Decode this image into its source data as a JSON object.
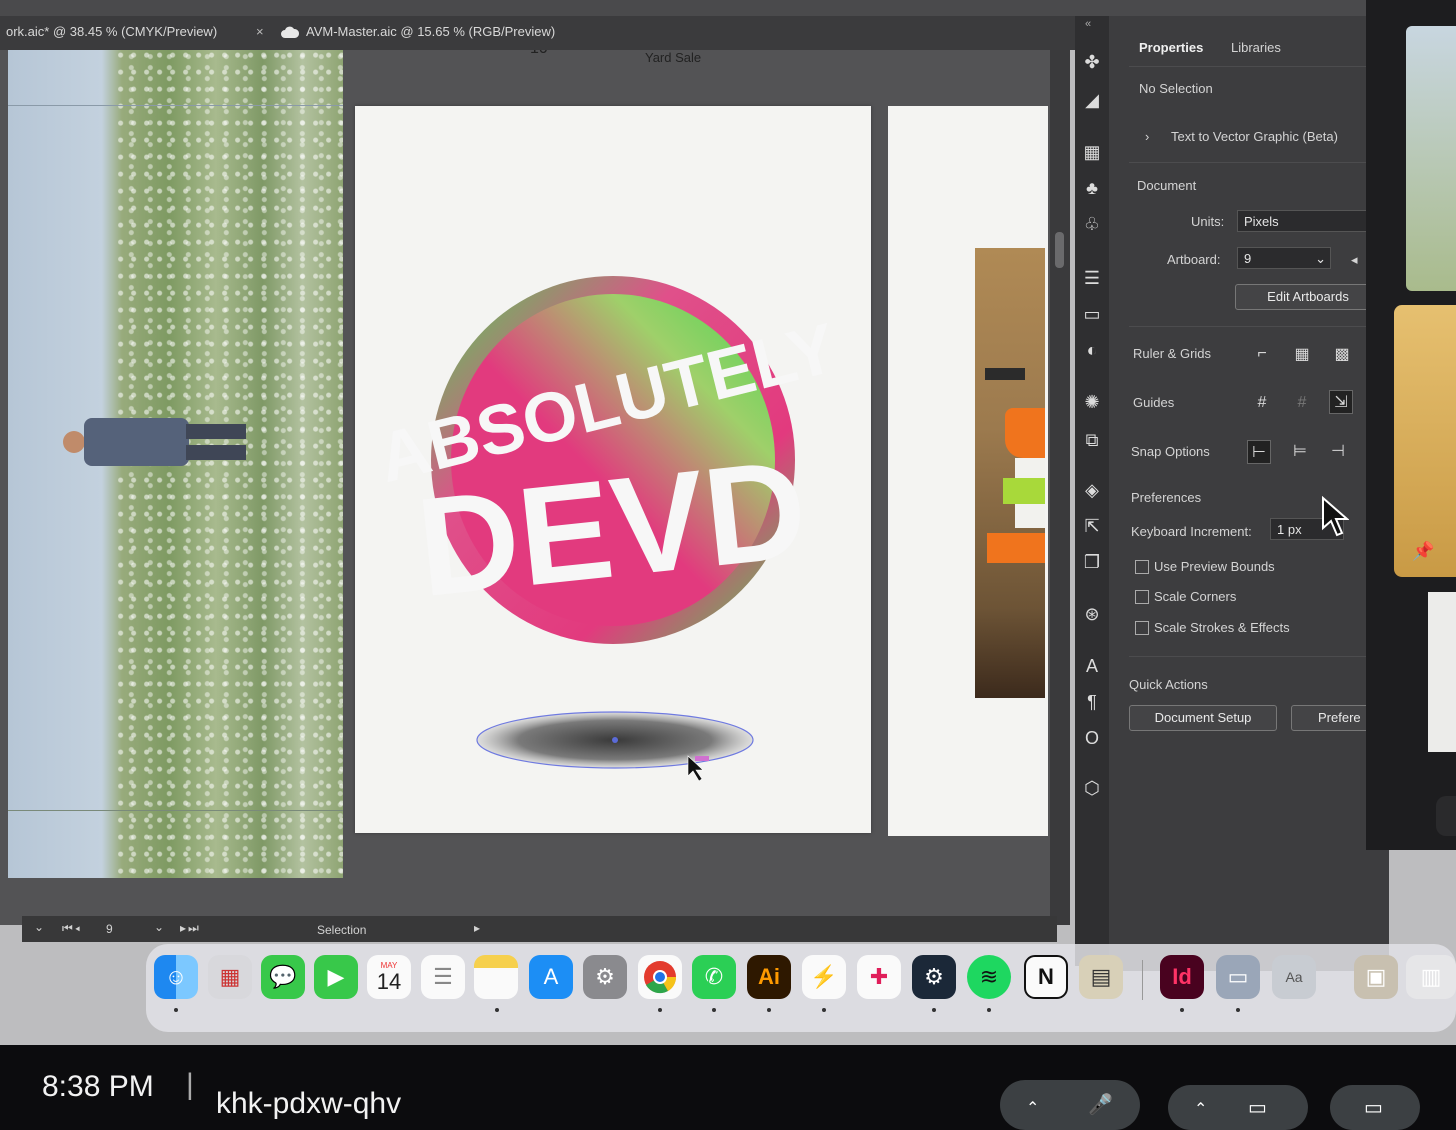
{
  "document_tabs": {
    "tab1": "ork.aic* @ 38.45 % (CMYK/Preview)",
    "tab1_close": "×",
    "tab2": "AVM-Master.aic @ 15.65 % (RGB/Preview)"
  },
  "artboard_labels": {
    "number": "10",
    "name": "Yard Sale"
  },
  "artwork": {
    "line1": "ABSOLUTELY",
    "line2": "DEVD"
  },
  "properties_panel": {
    "tab_properties": "Properties",
    "tab_libraries": "Libraries",
    "no_selection": "No Selection",
    "text_to_vector": "Text to Vector Graphic (Beta)",
    "document_heading": "Document",
    "units_label": "Units:",
    "units_value": "Pixels",
    "artboard_label": "Artboard:",
    "artboard_value": "9",
    "edit_artboards": "Edit Artboards",
    "ruler_grids": "Ruler & Grids",
    "guides": "Guides",
    "snap_options": "Snap Options",
    "preferences_heading": "Preferences",
    "keyboard_increment_label": "Keyboard Increment:",
    "keyboard_increment_value": "1 px",
    "use_preview_bounds": "Use Preview Bounds",
    "scale_corners": "Scale Corners",
    "scale_strokes": "Scale Strokes & Effects",
    "quick_actions": "Quick Actions",
    "document_setup": "Document Setup",
    "preferences_button": "Prefere"
  },
  "status_bar": {
    "artboard_number": "9",
    "tool": "Selection"
  },
  "dock": {
    "calendar_month": "MAY",
    "calendar_day": "14",
    "illustrator": "Ai",
    "indesign": "Id",
    "notion": "N"
  },
  "taskbar": {
    "time": "8:38 PM",
    "separator": "|",
    "meeting_code": "khk-pdxw-qhv"
  },
  "colors": {
    "art_green": "#4ad452",
    "art_pink": "#e23a7e",
    "illustrator_bg": "#2e1800",
    "illustrator_fg": "#ff9a00",
    "indesign_bg": "#49021f",
    "indesign_fg": "#ff3366"
  }
}
